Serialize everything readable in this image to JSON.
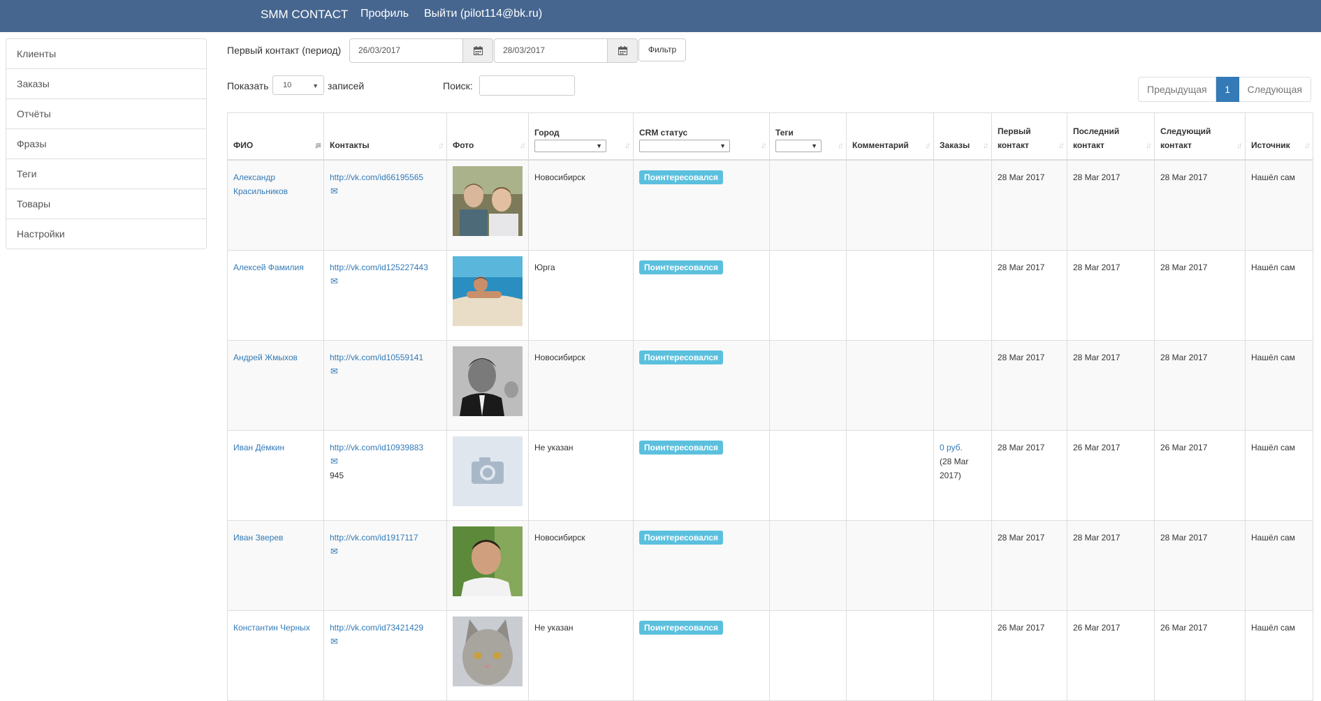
{
  "navbar": {
    "brand": "SMM CONTACT",
    "profile": "Профиль",
    "logout": "Выйти (pilot114@bk.ru)"
  },
  "sidebar": {
    "items": [
      {
        "label": "Клиенты"
      },
      {
        "label": "Заказы"
      },
      {
        "label": "Отчёты"
      },
      {
        "label": "Фразы"
      },
      {
        "label": "Теги"
      },
      {
        "label": "Товары"
      },
      {
        "label": "Настройки"
      }
    ]
  },
  "filter": {
    "label": "Первый контакт (период)",
    "date_from": "26/03/2017",
    "date_to": "28/03/2017",
    "button": "Фильтр",
    "calendar_icon": "calendar-icon"
  },
  "controls": {
    "show_label": "Показать",
    "page_size": "10",
    "records_label": "записей",
    "search_label": "Поиск:",
    "search_value": ""
  },
  "pagination": {
    "prev": "Предыдущая",
    "current": "1",
    "next": "Следующая"
  },
  "table": {
    "headers": {
      "fio": "ФИО",
      "contacts": "Контакты",
      "photo": "Фото",
      "city": "Город",
      "crm": "CRM статус",
      "tags": "Теги",
      "comment": "Комментарий",
      "orders": "Заказы",
      "first_1": "Первый",
      "first_2": "контакт",
      "last_1": "Последний",
      "last_2": "контакт",
      "next_1": "Следующий",
      "next_2": "контакт",
      "source": "Источник"
    },
    "rows": [
      {
        "name": "Александр Красильников",
        "link": "http://vk.com/id66195565",
        "extra": "",
        "city": "Новосибирск",
        "status": "Поинтересовался",
        "orders_link": "",
        "orders_date": "",
        "first": "28 Mar 2017",
        "last": "28 Mar 2017",
        "next": "28 Mar 2017",
        "source": "Нашёл сам",
        "photo": "photo-two-young-men"
      },
      {
        "name": "Алексей Фамилия",
        "link": "http://vk.com/id125227443",
        "extra": "",
        "city": "Юрга",
        "status": "Поинтересовался",
        "orders_link": "",
        "orders_date": "",
        "first": "28 Mar 2017",
        "last": "28 Mar 2017",
        "next": "28 Mar 2017",
        "source": "Нашёл сам",
        "photo": "photo-man-in-pool"
      },
      {
        "name": "Андрей Жмыхов",
        "link": "http://vk.com/id10559141",
        "extra": "",
        "city": "Новосибирск",
        "status": "Поинтересовался",
        "orders_link": "",
        "orders_date": "",
        "first": "28 Mar 2017",
        "last": "28 Mar 2017",
        "next": "28 Mar 2017",
        "source": "Нашёл сам",
        "photo": "photo-bw-man-suit"
      },
      {
        "name": "Иван Дёмкин",
        "link": "http://vk.com/id10939883",
        "extra": "945",
        "city": "Не указан",
        "status": "Поинтересовался",
        "orders_link": "0 руб.",
        "orders_date": "(28 Mar 2017)",
        "first": "28 Mar 2017",
        "last": "26 Mar 2017",
        "next": "26 Mar 2017",
        "source": "Нашёл сам",
        "photo": "camera-placeholder-icon"
      },
      {
        "name": "Иван Зверев",
        "link": "http://vk.com/id1917117",
        "extra": "",
        "city": "Новосибирск",
        "status": "Поинтересовался",
        "orders_link": "",
        "orders_date": "",
        "first": "28 Mar 2017",
        "last": "28 Mar 2017",
        "next": "28 Mar 2017",
        "source": "Нашёл сам",
        "photo": "photo-man-portrait"
      },
      {
        "name": "Константин Черных",
        "link": "http://vk.com/id73421429",
        "extra": "",
        "city": "Не указан",
        "status": "Поинтересовался",
        "orders_link": "",
        "orders_date": "",
        "first": "26 Mar 2017",
        "last": "26 Mar 2017",
        "next": "26 Mar 2017",
        "source": "Нашёл сам",
        "photo": "photo-gray-cat"
      }
    ]
  },
  "colors": {
    "navbar": "#46668f",
    "link": "#337ab7",
    "badge": "#5bc0de"
  }
}
